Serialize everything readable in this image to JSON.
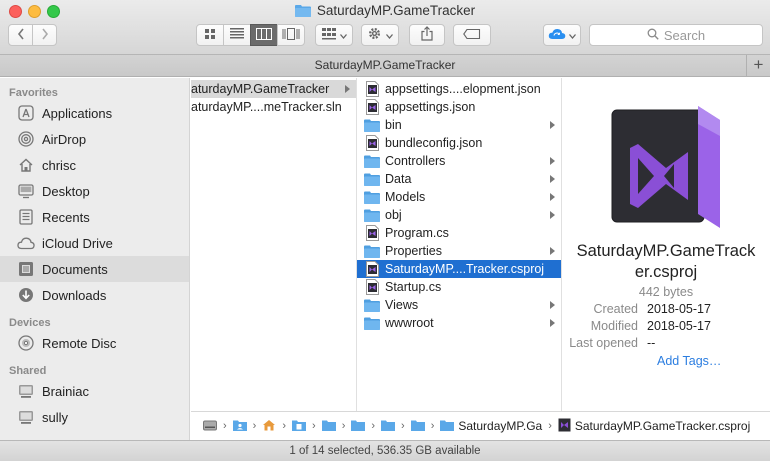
{
  "window": {
    "title": "SaturdayMP.GameTracker"
  },
  "toolbar": {
    "search_placeholder": "Search"
  },
  "tab": {
    "label": "SaturdayMP.GameTracker",
    "add_label": "+"
  },
  "sidebar": {
    "favorites_header": "Favorites",
    "favorites": [
      {
        "label": "Applications",
        "icon": "applications-icon"
      },
      {
        "label": "AirDrop",
        "icon": "airdrop-icon"
      },
      {
        "label": "chrisc",
        "icon": "home-icon"
      },
      {
        "label": "Desktop",
        "icon": "desktop-icon"
      },
      {
        "label": "Recents",
        "icon": "recents-icon"
      },
      {
        "label": "iCloud Drive",
        "icon": "cloud-icon"
      },
      {
        "label": "Documents",
        "icon": "documents-icon"
      },
      {
        "label": "Downloads",
        "icon": "downloads-icon"
      }
    ],
    "devices_header": "Devices",
    "devices": [
      {
        "label": "Remote Disc",
        "icon": "disc-icon"
      }
    ],
    "shared_header": "Shared",
    "shared": [
      {
        "label": "Brainiac",
        "icon": "computer-icon"
      },
      {
        "label": "sully",
        "icon": "computer-icon"
      }
    ]
  },
  "columns": {
    "col1": [
      {
        "label": "aturdayMP.GameTracker",
        "icon": "folder-icon",
        "has_children": true,
        "state": "highlighted"
      },
      {
        "label": "aturdayMP....meTracker.sln",
        "icon": "file-icon",
        "has_children": false,
        "state": "none"
      }
    ],
    "col2": [
      {
        "label": "appsettings....elopment.json",
        "icon": "vs-file-icon",
        "has_children": false,
        "state": "none"
      },
      {
        "label": "appsettings.json",
        "icon": "vs-file-icon",
        "has_children": false,
        "state": "none"
      },
      {
        "label": "bin",
        "icon": "folder-icon",
        "has_children": true,
        "state": "none"
      },
      {
        "label": "bundleconfig.json",
        "icon": "vs-file-icon",
        "has_children": false,
        "state": "none"
      },
      {
        "label": "Controllers",
        "icon": "folder-icon",
        "has_children": true,
        "state": "none"
      },
      {
        "label": "Data",
        "icon": "folder-icon",
        "has_children": true,
        "state": "none"
      },
      {
        "label": "Models",
        "icon": "folder-icon",
        "has_children": true,
        "state": "none"
      },
      {
        "label": "obj",
        "icon": "folder-icon",
        "has_children": true,
        "state": "none"
      },
      {
        "label": "Program.cs",
        "icon": "vs-file-icon",
        "has_children": false,
        "state": "none"
      },
      {
        "label": "Properties",
        "icon": "folder-icon",
        "has_children": true,
        "state": "none"
      },
      {
        "label": "SaturdayMP....Tracker.csproj",
        "icon": "vs-file-icon",
        "has_children": false,
        "state": "selected"
      },
      {
        "label": "Startup.cs",
        "icon": "vs-file-icon",
        "has_children": false,
        "state": "none"
      },
      {
        "label": "Views",
        "icon": "folder-icon",
        "has_children": true,
        "state": "none"
      },
      {
        "label": "wwwroot",
        "icon": "folder-icon",
        "has_children": true,
        "state": "none"
      }
    ]
  },
  "preview": {
    "name_line1": "SaturdayMP.GameTrack",
    "name_line2": "er.csproj",
    "size": "442 bytes",
    "created_label": "Created",
    "created_value": "2018-05-17",
    "modified_label": "Modified",
    "modified_value": "2018-05-17",
    "last_opened_label": "Last opened",
    "last_opened_value": "--",
    "add_tags": "Add Tags…"
  },
  "pathbar": {
    "folder_label": "SaturdayMP.Ga",
    "file_label": "SaturdayMP.GameTracker.csproj"
  },
  "status": {
    "text": "1 of 14 selected, 536.35 GB available"
  },
  "colors": {
    "selection": "#1f6fd1",
    "vs_purple": "#8a4fd6",
    "folder_blue": "#5aa8e8"
  }
}
